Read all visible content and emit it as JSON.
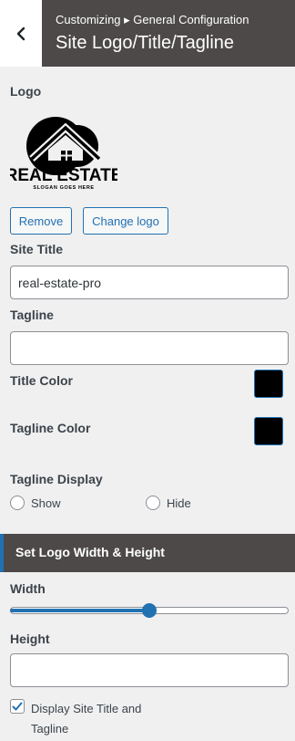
{
  "header": {
    "breadcrumb": "Customizing ▸ General Configuration",
    "title": "Site Logo/Title/Tagline"
  },
  "logo": {
    "label": "Logo",
    "image_text": "REAL ESTATE",
    "image_subtext": "SLOGAN GOES HERE",
    "remove_label": "Remove",
    "change_label": "Change logo"
  },
  "site_title": {
    "label": "Site Title",
    "value": "real-estate-pro"
  },
  "tagline": {
    "label": "Tagline",
    "value": ""
  },
  "title_color": {
    "label": "Title Color",
    "value": "#000000"
  },
  "tagline_color": {
    "label": "Tagline Color",
    "value": "#000000"
  },
  "tagline_display": {
    "label": "Tagline Display",
    "options": [
      "Show",
      "Hide"
    ],
    "selected": null
  },
  "logo_size": {
    "section_title": "Set Logo Width & Height",
    "width_label": "Width",
    "width_fraction": 0.5,
    "height_label": "Height",
    "height_value": ""
  },
  "display_title": {
    "label": "Display Site Title and Tagline",
    "checked": true
  },
  "colors": {
    "accent": "#2271b1",
    "header_bg": "#4d4949",
    "panel_bg": "#f0f0f1"
  }
}
